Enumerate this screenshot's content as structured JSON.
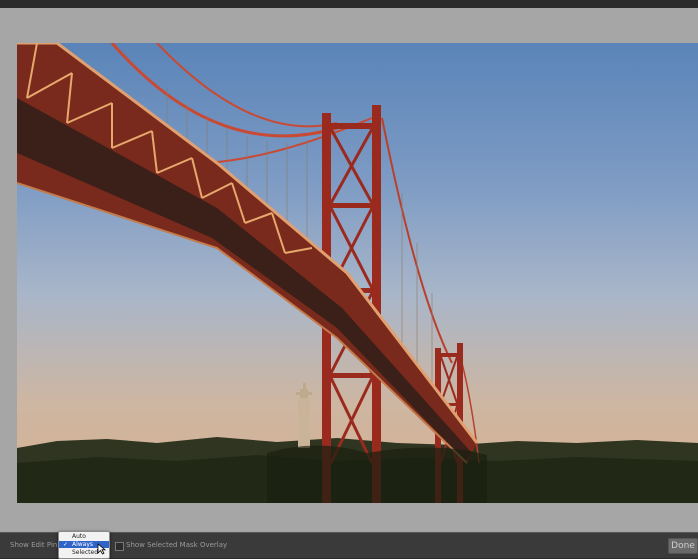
{
  "toolbar": {
    "show_edit_pins_label": "Show Edit Pins:",
    "show_mask_label": "Show Selected Mask Overlay",
    "done_label": "Done"
  },
  "pins_menu": {
    "items": [
      "Auto",
      "Always",
      "Selected"
    ],
    "selected": "Always"
  },
  "photo": {
    "subject": "suspension bridge at sunset"
  },
  "colors": {
    "canvas": "#a6a6a6",
    "toolbar": "#3a3a3a",
    "menu_highlight": "#2f64c9",
    "bridge": "#9b2a1e"
  },
  "icons": [
    "checkmark-icon",
    "cursor-icon"
  ]
}
